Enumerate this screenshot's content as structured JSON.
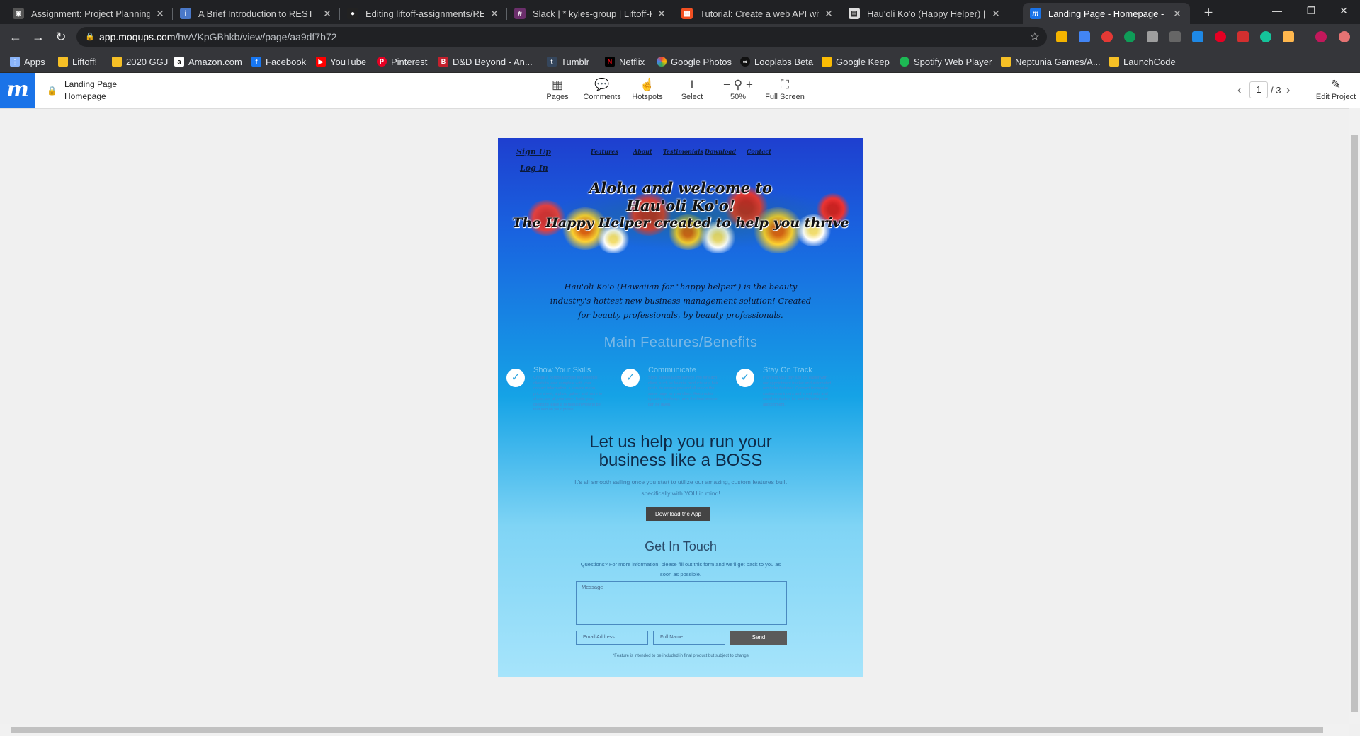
{
  "browser": {
    "tabs": [
      {
        "title": "Assignment: Project Planning —",
        "active": false
      },
      {
        "title": "A Brief Introduction to REST",
        "active": false
      },
      {
        "title": "Editing liftoff-assignments/READ",
        "active": false
      },
      {
        "title": "Slack | * kyles-group | Liftoff-Feb",
        "active": false
      },
      {
        "title": "Tutorial: Create a web API with A",
        "active": false
      },
      {
        "title": "Hau'oli Ko'o (Happy Helper) | Tre",
        "active": false
      },
      {
        "title": "Landing Page - Homepage - Moq",
        "active": true
      }
    ],
    "url_host": "app.moqups.com",
    "url_path": "/hwVKpGBhkb/view/page/aa9df7b72",
    "bookmarks": [
      {
        "label": "Apps",
        "icon": "apps-grid-icon"
      },
      {
        "label": "Liftoff!",
        "icon": "folder-icon"
      },
      {
        "label": "2020 GGJ",
        "icon": "folder-icon"
      },
      {
        "label": "Amazon.com",
        "icon": "amazon-icon"
      },
      {
        "label": "Facebook",
        "icon": "facebook-icon"
      },
      {
        "label": "YouTube",
        "icon": "youtube-icon"
      },
      {
        "label": "Pinterest",
        "icon": "pinterest-icon"
      },
      {
        "label": "D&D Beyond - An...",
        "icon": "dndbeyond-icon"
      },
      {
        "label": "Tumblr",
        "icon": "tumblr-icon"
      },
      {
        "label": "Netflix",
        "icon": "netflix-icon"
      },
      {
        "label": "Google Photos",
        "icon": "google-photos-icon"
      },
      {
        "label": "Looplabs Beta",
        "icon": "looplabs-icon"
      },
      {
        "label": "Google Keep",
        "icon": "google-keep-icon"
      },
      {
        "label": "Spotify Web Player",
        "icon": "spotify-icon"
      },
      {
        "label": "Neptunia Games/A...",
        "icon": "folder-icon"
      },
      {
        "label": "LaunchCode",
        "icon": "folder-icon"
      }
    ]
  },
  "app": {
    "page_title_line1": "Landing Page",
    "page_title_line2": "Homepage",
    "tools": {
      "pages": "Pages",
      "comments": "Comments",
      "hotspots": "Hotspots",
      "select": "Select",
      "zoom": "50%",
      "fullscreen": "Full Screen"
    },
    "pager": {
      "current": "1",
      "total": "/ 3"
    },
    "edit_project": "Edit Project"
  },
  "mockup": {
    "nav": {
      "signup": "Sign Up",
      "login": "Log In",
      "features": "Features",
      "about": "About",
      "testimonials": "Testimonials",
      "download": "Download",
      "contact": "Contact"
    },
    "headline": {
      "line1": "Aloha and welcome to",
      "line2": "Hau'oli Ko'o!",
      "line3": "The Happy Helper created to help you thrive"
    },
    "intro": "Hau'oli Ko'o (Hawaiian for \"happy helper\") is the beauty industry's hottest new business management solution! Created for beauty professionals, by beauty professionals.",
    "features_heading": "Main Features/Benefits",
    "features": [
      {
        "title": "Show Your Skills",
        "body": "Create a personal profile for potential clients to view complete with your contact information, a service menu, price sheet, a photo gallery and more to showcase all your work. Invite your clients to leave a personal review to be featured on your profile."
      },
      {
        "title": "Communicate",
        "body": "Store personal and service info for each client, such as favorite products or a hair goals, to ensure you and all are on the same page as your client. Keep notes updated to always have the best service can be given."
      },
      {
        "title": "Stay On Track",
        "body": "Planning your day just got easier with our appointment tracker and automated reminder features. Connect to receive custom reminders and sheet sets and email reminders for a while before the appointment."
      }
    ],
    "boss_line1": "Let us help you run your",
    "boss_line2": "business like a BOSS",
    "boss_sub": "It's all smooth sailing once you start to utilize our amazing, custom features built specifically with YOU in mind!",
    "download_button": "Download the App",
    "contact_heading": "Get In Touch",
    "contact_sub": "Questions? For more information, please fill out this form and we'll get back to you as soon as possible.",
    "message_placeholder": "Message",
    "email_placeholder": "Email Address",
    "name_placeholder": "Full Name",
    "send_button": "Send",
    "footnote": "*Feature is intended to be included in final product but subject to change"
  }
}
